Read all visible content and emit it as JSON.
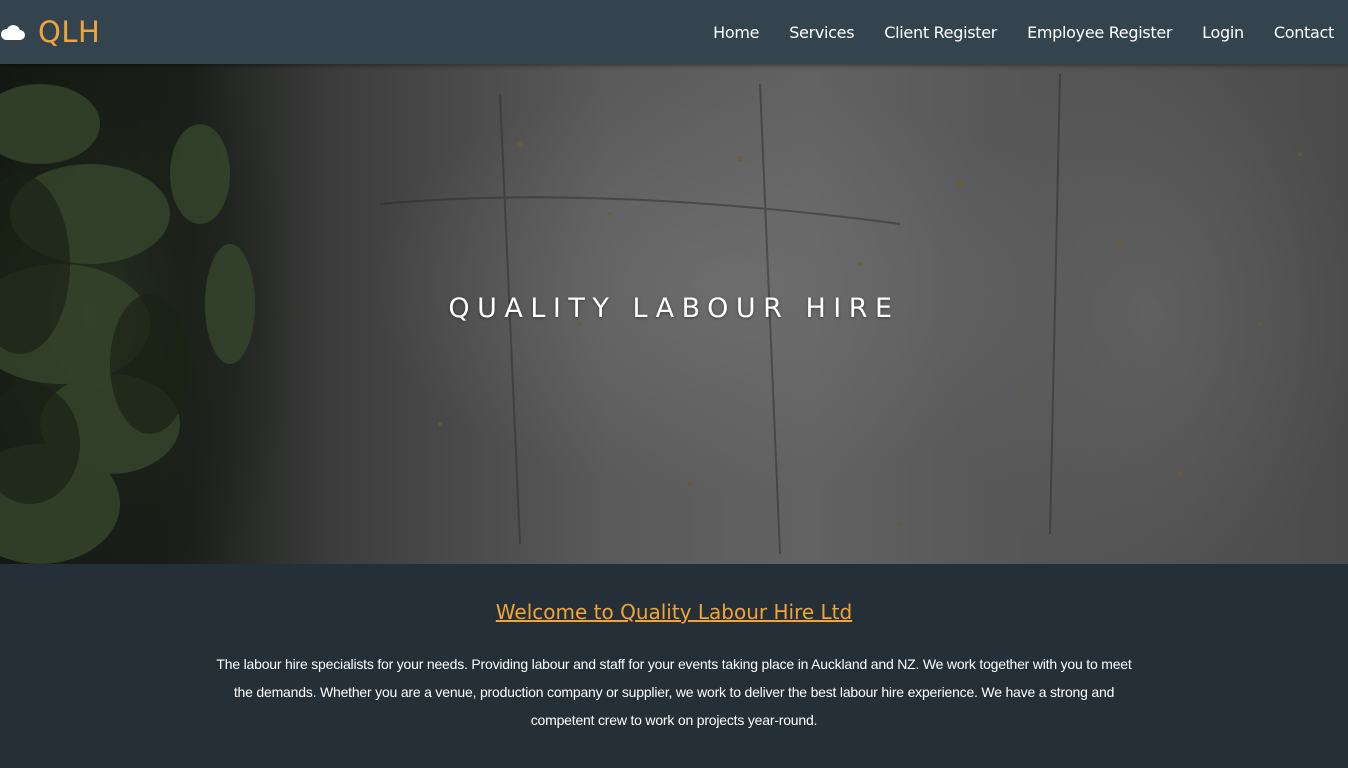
{
  "brand": {
    "logo_icon": "cloud-icon",
    "name": "QLH"
  },
  "nav": {
    "items": [
      {
        "label": "Home"
      },
      {
        "label": "Services"
      },
      {
        "label": "Client Register"
      },
      {
        "label": "Employee Register"
      },
      {
        "label": "Login"
      },
      {
        "label": "Contact"
      }
    ]
  },
  "hero": {
    "title": "QUALITY LABOUR HIRE"
  },
  "welcome": {
    "heading": "Welcome to Quality Labour Hire Ltd",
    "body": "The labour hire specialists for your needs. Providing labour and staff for your events taking place in Auckland and NZ. We work together with you to meet the demands. Whether you are a venue, production company or supplier, we work to deliver the best labour hire experience. We have a strong and competent crew to work on projects year-round."
  },
  "colors": {
    "navbar": "#34444f",
    "accent": "#f0a43a",
    "section_bg": "#242f37",
    "text": "#ffffff"
  }
}
